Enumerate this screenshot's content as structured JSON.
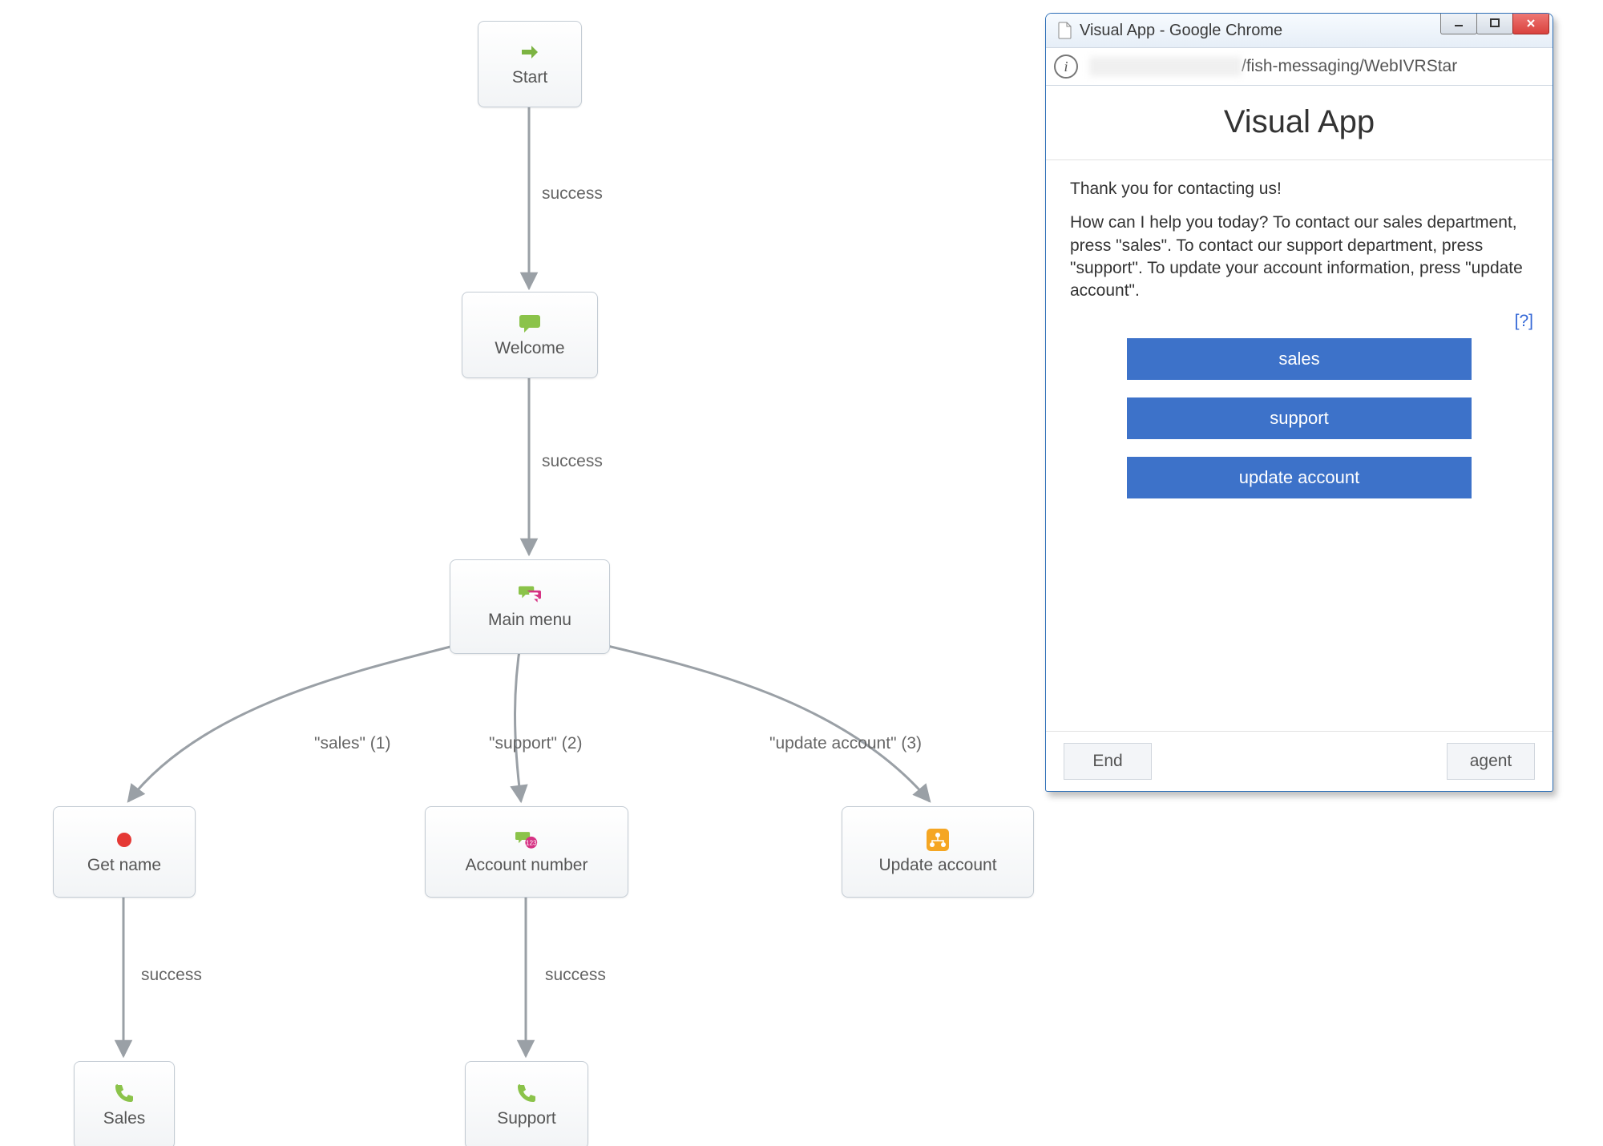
{
  "flow": {
    "nodes": {
      "start": {
        "label": "Start"
      },
      "welcome": {
        "label": "Welcome"
      },
      "main_menu": {
        "label": "Main menu"
      },
      "get_name": {
        "label": "Get name"
      },
      "account_number": {
        "label": "Account number"
      },
      "update_account": {
        "label": "Update account"
      },
      "sales": {
        "label": "Sales"
      },
      "support": {
        "label": "Support"
      }
    },
    "edges": {
      "start_welcome": {
        "label": "success"
      },
      "welcome_main": {
        "label": "success"
      },
      "main_getname": {
        "label": "\"sales\" (1)"
      },
      "main_account": {
        "label": "\"support\" (2)"
      },
      "main_update": {
        "label": "\"update account\" (3)"
      },
      "getname_sales": {
        "label": "success"
      },
      "account_support": {
        "label": "success"
      }
    }
  },
  "chrome": {
    "title": "Visual App - Google Chrome",
    "url_path": "/fish-messaging/WebIVRStar"
  },
  "page": {
    "heading": "Visual App",
    "greeting": "Thank you for contacting us!",
    "prompt": "How can I help you today? To contact our sales department, press \"sales\". To contact our support department, press \"support\". To update your account information, press \"update account\".",
    "help": "[?]",
    "buttons": {
      "sales": "sales",
      "support": "support",
      "update": "update account"
    },
    "footer": {
      "end": "End",
      "agent": "agent"
    }
  }
}
